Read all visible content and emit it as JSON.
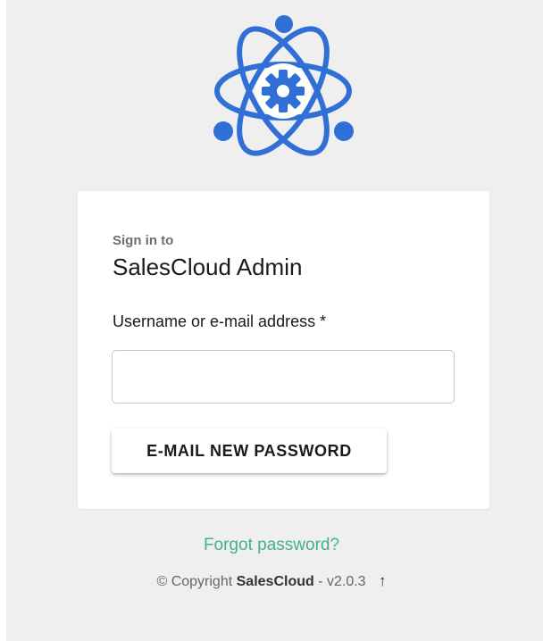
{
  "brand": {
    "logo_icon": "atom-gear-icon",
    "accent_color": "#2f6fd6"
  },
  "login": {
    "sign_in_prefix": "Sign in to",
    "app_name": "SalesCloud Admin",
    "username_label": "Username or e-mail address *",
    "username_value": "",
    "username_placeholder": "",
    "submit_label": "E-MAIL NEW PASSWORD"
  },
  "links": {
    "forgot_password": "Forgot password?",
    "link_color": "#45b091"
  },
  "footer": {
    "copyright_prefix": "© Copyright",
    "brand_name": "SalesCloud",
    "version_text": "- v2.0.3",
    "up_icon": "arrow-up-icon",
    "up_glyph": "↑"
  }
}
